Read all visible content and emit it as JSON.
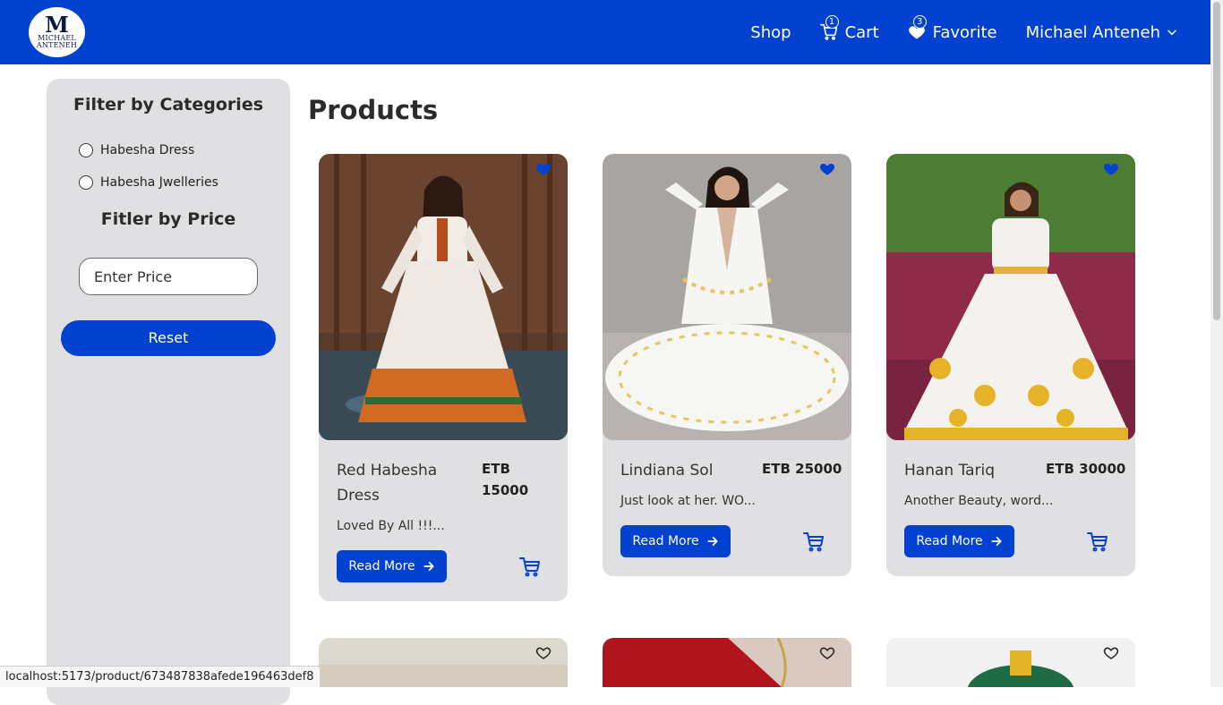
{
  "brand": {
    "line1": "MICHAEL",
    "line2": "ANTENEH",
    "mark": "M"
  },
  "nav": {
    "shop": "Shop",
    "cart": "Cart",
    "cart_count": "1",
    "favorite": "Favorite",
    "favorite_count": "3",
    "user": "Michael Anteneh"
  },
  "sidebar": {
    "categories_title": "Filter by Categories",
    "categories": [
      "Habesha Dress",
      "Habesha Jwelleries"
    ],
    "price_title": "Fitler by Price",
    "price_placeholder": "Enter Price",
    "reset": "Reset"
  },
  "main": {
    "title": "Products",
    "products": [
      {
        "name": "Red Habesha Dress",
        "price": "ETB 15000",
        "desc": "Loved By All !!!...",
        "read_more": "Read More"
      },
      {
        "name": "Lindiana Sol",
        "price": "ETB 25000",
        "desc": "Just look at her. WO...",
        "read_more": "Read More"
      },
      {
        "name": "Hanan Tariq",
        "price": "ETB 30000",
        "desc": "Another Beauty, word...",
        "read_more": "Read More"
      }
    ]
  },
  "status_url": "localhost:5173/product/673487838afede196463def8",
  "colors": {
    "primary": "#0341d1",
    "card": "#e0e0e3"
  }
}
